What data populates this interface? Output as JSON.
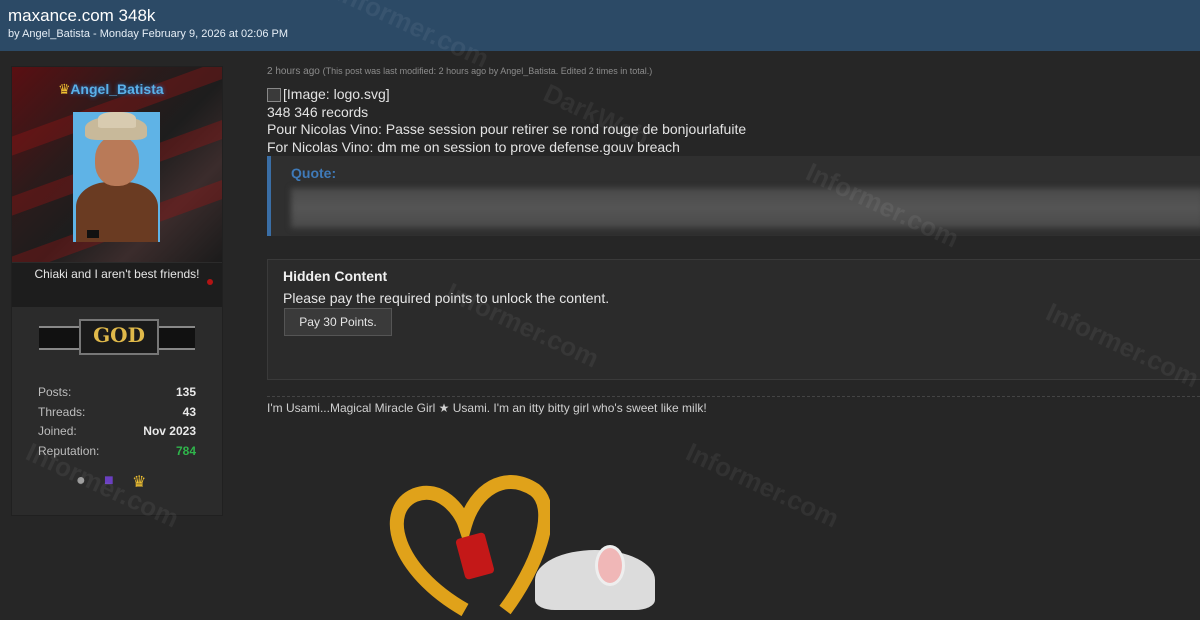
{
  "header": {
    "title": "maxance.com 348k",
    "meta": "by Angel_Batista - Monday February 9, 2026 at 02:06 PM"
  },
  "user": {
    "username": "Angel_Batista",
    "user_title": "Chiaki and I aren't best friends!",
    "rank": "GOD",
    "stats": [
      {
        "label": "Posts:",
        "value": "135"
      },
      {
        "label": "Threads:",
        "value": "43"
      },
      {
        "label": "Joined:",
        "value": "Nov 2023"
      },
      {
        "label": "Reputation:",
        "value": "784"
      }
    ],
    "colors": {
      "username": "#5ab0e8",
      "reputation": "#2fb54b"
    }
  },
  "post": {
    "time": "2 hours ago",
    "modified": "(This post was last modified: 2 hours ago by Angel_Batista. Edited 2 times in total.)",
    "image_alt": "[Image: logo.svg]",
    "lines": [
      "348 346 records",
      "Pour Nicolas Vino: Passe session pour retirer se rond rouge de bonjourlafuite",
      "For Nicolas Vino: dm me on session to prove defense.gouv breach"
    ],
    "quote_label": "Quote:"
  },
  "hidden_content": {
    "title": "Hidden Content",
    "description": "Please pay the required points to unlock the content.",
    "button_label": "Pay 30 Points."
  },
  "signature": {
    "text": "I'm Usami...Magical Miracle Girl ★ Usami. I'm an itty bitty girl who's sweet like milk!"
  },
  "watermark": {
    "text_a": "DarkWeb",
    "text_b": "Informer.com"
  }
}
